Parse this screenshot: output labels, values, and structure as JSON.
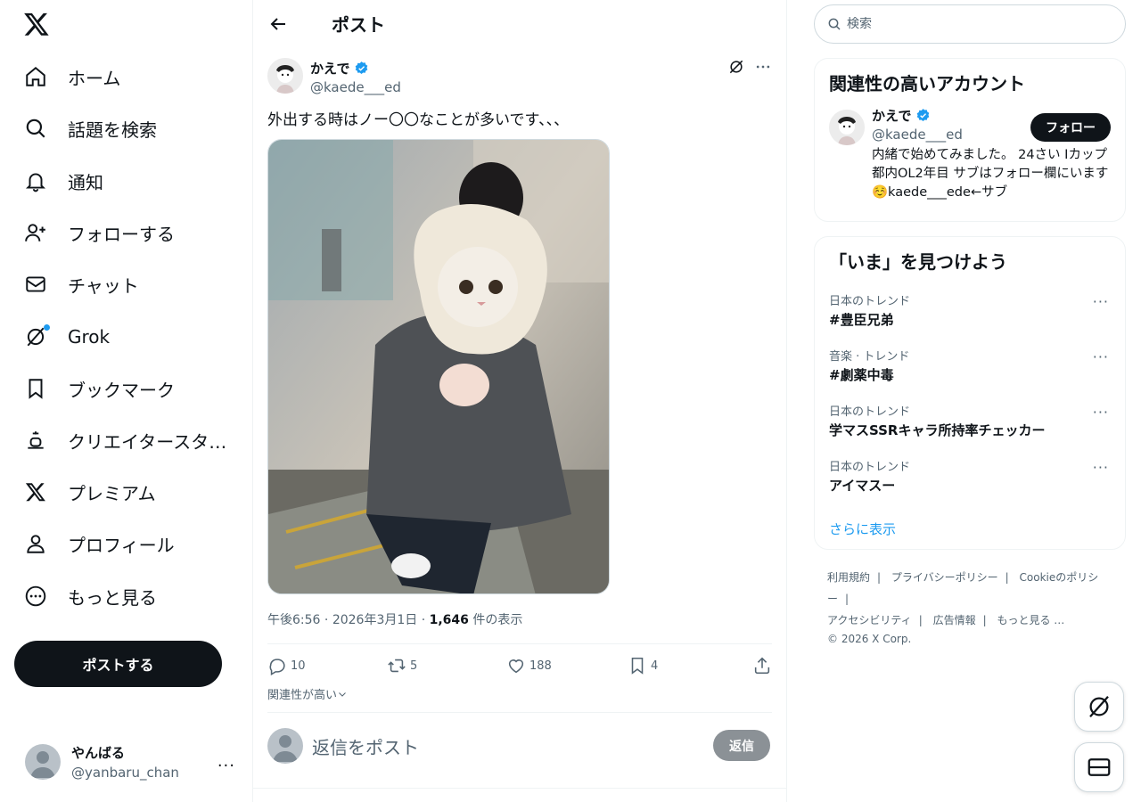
{
  "nav": {
    "items": [
      {
        "label": "ホーム",
        "icon": "home-icon"
      },
      {
        "label": "話題を検索",
        "icon": "search-icon"
      },
      {
        "label": "通知",
        "icon": "bell-icon"
      },
      {
        "label": "フォローする",
        "icon": "add-user-icon"
      },
      {
        "label": "チャット",
        "icon": "mail-icon"
      },
      {
        "label": "Grok",
        "icon": "grok-icon"
      },
      {
        "label": "ブックマーク",
        "icon": "bookmark-icon"
      },
      {
        "label": "クリエイタースタ…",
        "icon": "creator-icon"
      },
      {
        "label": "プレミアム",
        "icon": "x-logo-icon"
      },
      {
        "label": "プロフィール",
        "icon": "profile-icon"
      },
      {
        "label": "もっと見る",
        "icon": "more-circle-icon"
      }
    ],
    "post_button": "ポストする",
    "account": {
      "name": "やんばる",
      "handle": "@yanbaru_chan",
      "more": "..."
    }
  },
  "header": {
    "title": "ポスト"
  },
  "post": {
    "author_name": "かえで",
    "author_handle": "@kaede___ed",
    "text": "外出する時はノー〇〇なことが多いです、、、",
    "time": "午後6:56",
    "date": "2026年3月1日",
    "views_count": "1,646",
    "views_label": "件の表示",
    "stats": {
      "replies": "10",
      "reposts": "5",
      "likes": "188",
      "bookmarks": "4"
    },
    "relevance": "関連性が高い",
    "reply_placeholder": "返信をポスト",
    "reply_button": "返信"
  },
  "search": {
    "placeholder": "検索"
  },
  "recommended": {
    "title": "関連性の高いアカウント",
    "name": "かえで",
    "handle": "@kaede___ed",
    "follow": "フォロー",
    "bio": "内緒で始めてみました。 24さい Iカップ 都内OL2年目 サブはフォロー欄にいます☺️kaede___ede←サブ"
  },
  "trends": {
    "title": "「いま」を見つけよう",
    "items": [
      {
        "context": "日本のトレンド",
        "name": "#豊臣兄弟"
      },
      {
        "context": "音楽 · トレンド",
        "name": "#劇薬中毒"
      },
      {
        "context": "日本のトレンド",
        "name": "学マスSSRキャラ所持率チェッカー"
      },
      {
        "context": "日本のトレンド",
        "name": "アイマスー"
      }
    ],
    "show_more": "さらに表示"
  },
  "footer": {
    "links": [
      "利用規約",
      "プライバシーポリシー",
      "Cookieのポリシー",
      "アクセシビリティ",
      "広告情報",
      "もっと見る …"
    ],
    "copyright": "© 2026 X Corp."
  },
  "colors": {
    "accent": "#1d9bf0",
    "text": "#0f1419",
    "muted": "#536471",
    "border": "#eff3f4"
  }
}
